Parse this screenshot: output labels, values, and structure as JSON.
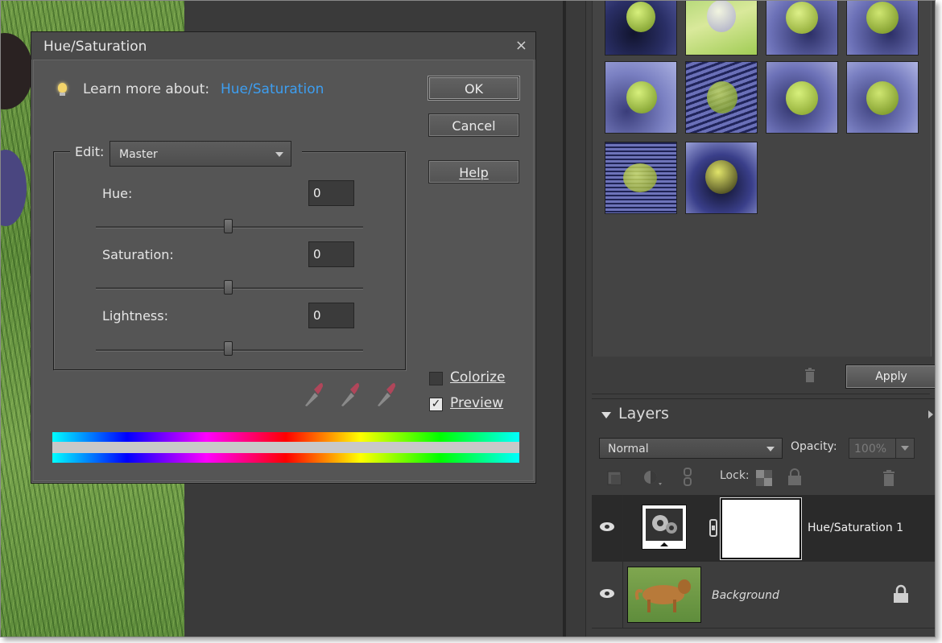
{
  "dialog": {
    "title": "Hue/Saturation",
    "close_glyph": "×",
    "learn_prefix": "Learn more about:",
    "learn_link": "Hue/Saturation",
    "buttons": {
      "ok": "OK",
      "cancel": "Cancel",
      "help": "Help"
    },
    "edit_label": "Edit:",
    "edit_value": "Master",
    "fields": [
      {
        "label": "Hue:",
        "value": "0"
      },
      {
        "label": "Saturation:",
        "value": "0"
      },
      {
        "label": "Lightness:",
        "value": "0"
      }
    ],
    "colorize_label": "Colorize",
    "colorize_checked": false,
    "preview_label": "Preview",
    "preview_checked": true,
    "preview_check_glyph": "✓"
  },
  "effects_panel": {
    "apply_label": "Apply",
    "thumbnail_icons": [
      "apple-thumbnail-icon"
    ]
  },
  "layers_panel": {
    "title": "Layers",
    "blend_mode": "Normal",
    "opacity_label": "Opacity:",
    "opacity_value": "100%",
    "lock_label": "Lock:",
    "layers": [
      {
        "name": "Hue/Saturation 1",
        "selected": true
      },
      {
        "name": "Background",
        "selected": false,
        "locked": true
      }
    ]
  },
  "colors": {
    "link": "#3d9ef0",
    "panel_bg": "#3d3d3d",
    "dialog_bg": "#555555"
  }
}
